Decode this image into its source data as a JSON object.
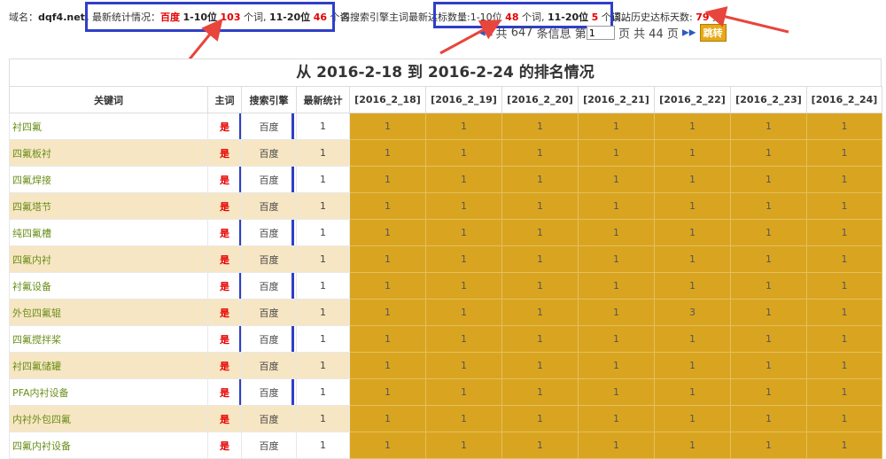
{
  "summary": {
    "domain_label": "域名：",
    "domain_value": "dqf4.net",
    "domain_end": "，",
    "latest_label": "最新统计情况：",
    "engine": "百度",
    "range1": "1-10位",
    "range1_count": "103",
    "unit1": "个词,",
    "range2": "11-20位",
    "range2_count": "46",
    "unit2": "个词",
    "engine_stat_label": "各搜索引擎主词最新达标数量:1-10位",
    "engine_stat_c1": "48",
    "engine_stat_u1": "个词,",
    "engine_stat_r2": "11-20位",
    "engine_stat_c2": "5",
    "engine_stat_u2": "个词。",
    "history_label": "该站历史达标天数:",
    "history_days": "79",
    "history_unit": "天"
  },
  "pager": {
    "total_prefix": "共",
    "total_count": "647",
    "total_suffix": "条信息 第",
    "page_value": "1",
    "pages_text": "页 共 44 页",
    "jump": "跳转"
  },
  "table": {
    "title": "从 2016-2-18 到 2016-2-24 的排名情况",
    "headers": {
      "keyword": "关键词",
      "main": "主词",
      "engine": "搜索引擎",
      "latest": "最新统计",
      "d1": "[2016_2_18]",
      "d2": "[2016_2_19]",
      "d3": "[2016_2_20]",
      "d4": "[2016_2_21]",
      "d5": "[2016_2_22]",
      "d6": "[2016_2_23]",
      "d7": "[2016_2_24]"
    },
    "rows": [
      {
        "kw": "衬四氟",
        "main": "是",
        "engine": "百度",
        "latest": "1",
        "d": [
          "1",
          "1",
          "1",
          "1",
          "1",
          "1",
          "1"
        ]
      },
      {
        "kw": "四氟板衬",
        "main": "是",
        "engine": "百度",
        "latest": "1",
        "d": [
          "1",
          "1",
          "1",
          "1",
          "1",
          "1",
          "1"
        ]
      },
      {
        "kw": "四氟焊接",
        "main": "是",
        "engine": "百度",
        "latest": "1",
        "d": [
          "1",
          "1",
          "1",
          "1",
          "1",
          "1",
          "1"
        ]
      },
      {
        "kw": "四氟塔节",
        "main": "是",
        "engine": "百度",
        "latest": "1",
        "d": [
          "1",
          "1",
          "1",
          "1",
          "1",
          "1",
          "1"
        ]
      },
      {
        "kw": "纯四氟槽",
        "main": "是",
        "engine": "百度",
        "latest": "1",
        "d": [
          "1",
          "1",
          "1",
          "1",
          "1",
          "1",
          "1"
        ]
      },
      {
        "kw": "四氟内衬",
        "main": "是",
        "engine": "百度",
        "latest": "1",
        "d": [
          "1",
          "1",
          "1",
          "1",
          "1",
          "1",
          "1"
        ]
      },
      {
        "kw": "衬氟设备",
        "main": "是",
        "engine": "百度",
        "latest": "1",
        "d": [
          "1",
          "1",
          "1",
          "1",
          "1",
          "1",
          "1"
        ]
      },
      {
        "kw": "外包四氟辊",
        "main": "是",
        "engine": "百度",
        "latest": "1",
        "d": [
          "1",
          "1",
          "1",
          "1",
          "3",
          "1",
          "1"
        ]
      },
      {
        "kw": "四氟搅拌桨",
        "main": "是",
        "engine": "百度",
        "latest": "1",
        "d": [
          "1",
          "1",
          "1",
          "1",
          "1",
          "1",
          "1"
        ]
      },
      {
        "kw": "衬四氟储罐",
        "main": "是",
        "engine": "百度",
        "latest": "1",
        "d": [
          "1",
          "1",
          "1",
          "1",
          "1",
          "1",
          "1"
        ]
      },
      {
        "kw": "PFA内衬设备",
        "main": "是",
        "engine": "百度",
        "latest": "1",
        "d": [
          "1",
          "1",
          "1",
          "1",
          "1",
          "1",
          "1"
        ]
      },
      {
        "kw": "内衬外包四氟",
        "main": "是",
        "engine": "百度",
        "latest": "1",
        "d": [
          "1",
          "1",
          "1",
          "1",
          "1",
          "1",
          "1"
        ]
      },
      {
        "kw": "四氟内衬设备",
        "main": "是",
        "engine": "百度",
        "latest": "1",
        "d": [
          "1",
          "1",
          "1",
          "1",
          "1",
          "1",
          "1"
        ]
      }
    ]
  },
  "colors": {
    "highlight_box": "#2f3fc8",
    "arrow": "#e8453c",
    "day_cell": "#d9a521",
    "alt_row": "#f7e6c3",
    "keyword_text": "#6a8f1a",
    "main_text": "#e60000"
  },
  "icons": {
    "prev_pair": "triangle-left-icon",
    "next_pair": "triangle-right-icon"
  }
}
